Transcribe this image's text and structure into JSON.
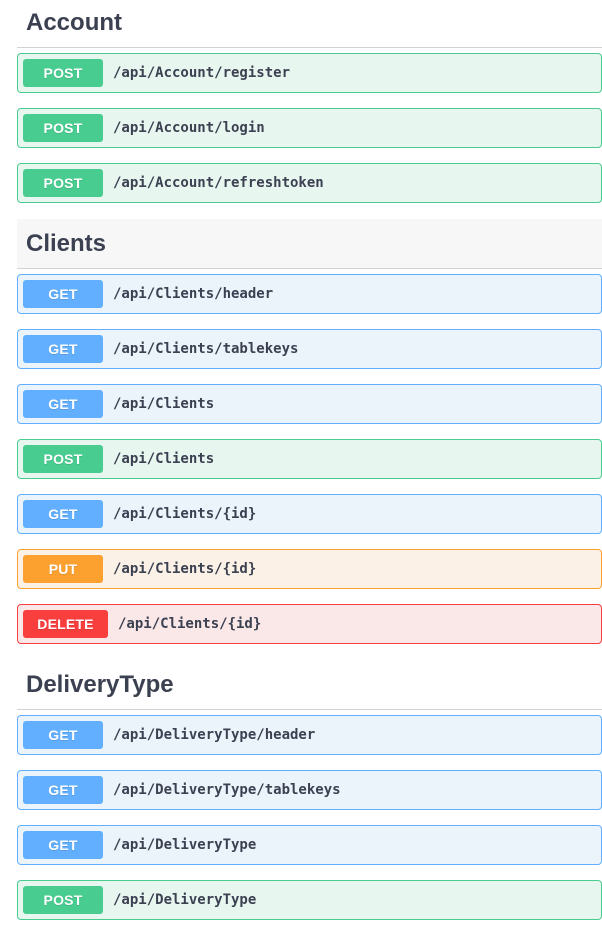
{
  "colors": {
    "post": "#49cc90",
    "get": "#61affe",
    "put": "#fca130",
    "delete": "#f93e3e",
    "text": "#3b4151"
  },
  "sections": [
    {
      "title": "Account",
      "operations": [
        {
          "method": "POST",
          "path": "/api/Account/register"
        },
        {
          "method": "POST",
          "path": "/api/Account/login"
        },
        {
          "method": "POST",
          "path": "/api/Account/refreshtoken"
        }
      ]
    },
    {
      "title": "Clients",
      "operations": [
        {
          "method": "GET",
          "path": "/api/Clients/header"
        },
        {
          "method": "GET",
          "path": "/api/Clients/tablekeys"
        },
        {
          "method": "GET",
          "path": "/api/Clients"
        },
        {
          "method": "POST",
          "path": "/api/Clients"
        },
        {
          "method": "GET",
          "path": "/api/Clients/{id}"
        },
        {
          "method": "PUT",
          "path": "/api/Clients/{id}"
        },
        {
          "method": "DELETE",
          "path": "/api/Clients/{id}"
        }
      ]
    },
    {
      "title": "DeliveryType",
      "operations": [
        {
          "method": "GET",
          "path": "/api/DeliveryType/header"
        },
        {
          "method": "GET",
          "path": "/api/DeliveryType/tablekeys"
        },
        {
          "method": "GET",
          "path": "/api/DeliveryType"
        },
        {
          "method": "POST",
          "path": "/api/DeliveryType"
        }
      ]
    }
  ]
}
